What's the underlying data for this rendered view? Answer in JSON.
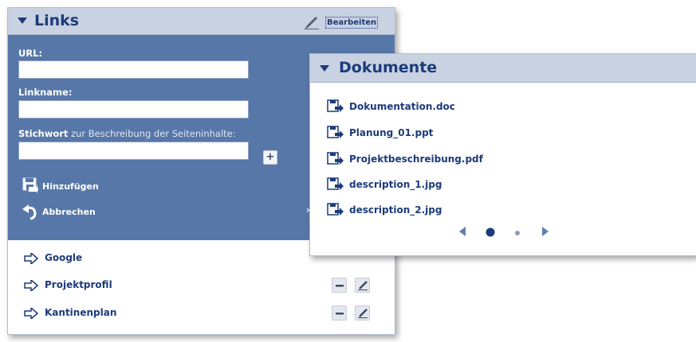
{
  "links_panel": {
    "title": "Links",
    "edit_label": "Bearbeiten",
    "form": {
      "url_label": "URL:",
      "url_value": "",
      "linkname_label": "Linkname:",
      "linkname_value": "",
      "stichwort_label_bold": "Stichwort",
      "stichwort_label_rest": " zur Beschreibung der Seiteninhalte:",
      "stichwort_value": "",
      "add_keyword_label": "+",
      "add_label": "Hinzufügen",
      "cancel_label": "Abbrechen"
    },
    "links": [
      {
        "label": "Google",
        "has_actions": false
      },
      {
        "label": "Projektprofil",
        "has_actions": true
      },
      {
        "label": "Kantinenplan",
        "has_actions": true
      }
    ]
  },
  "docs_panel": {
    "title": "Dokumente",
    "documents": [
      {
        "name": "Dokumentation.doc"
      },
      {
        "name": "Planung_01.ppt"
      },
      {
        "name": "Projektbeschreibung.pdf"
      },
      {
        "name": "description_1.jpg"
      },
      {
        "name": "description_2.jpg"
      }
    ],
    "pager": {
      "pages": 2,
      "current": 1
    }
  },
  "colors": {
    "header_bg": "#c9d2e2",
    "form_bg": "#5777a8",
    "link_text": "#1c3b7a"
  },
  "icons": {
    "collapse": "triangle-down-icon",
    "edit": "pencil-icon",
    "save": "save-icon",
    "undo": "undo-arrow-icon",
    "link": "arrow-right-icon",
    "document": "document-save-icon"
  }
}
